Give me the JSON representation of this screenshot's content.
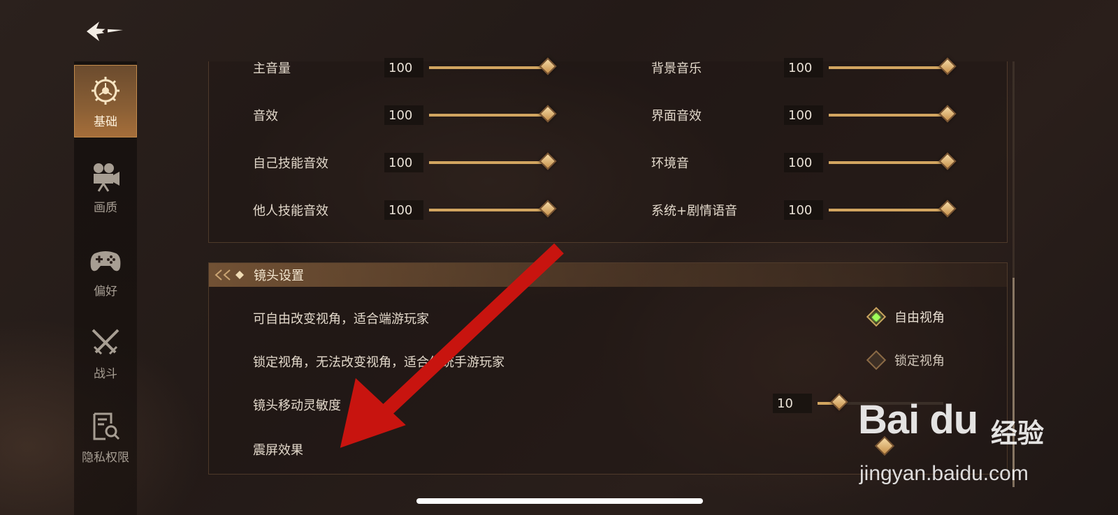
{
  "sidebar": {
    "back_icon": "back-arrow-icon",
    "items": [
      {
        "label": "基础",
        "icon": "gear-icon",
        "active": true
      },
      {
        "label": "画质",
        "icon": "camera-icon",
        "active": false
      },
      {
        "label": "偏好",
        "icon": "gamepad-icon",
        "active": false
      },
      {
        "label": "战斗",
        "icon": "crossed-swords-icon",
        "active": false
      },
      {
        "label": "隐私权限",
        "icon": "privacy-search-icon",
        "active": false
      }
    ]
  },
  "sound": {
    "rows": [
      {
        "label": "主音量",
        "value": "100"
      },
      {
        "label": "背景音乐",
        "value": "100"
      },
      {
        "label": "音效",
        "value": "100"
      },
      {
        "label": "界面音效",
        "value": "100"
      },
      {
        "label": "自己技能音效",
        "value": "100"
      },
      {
        "label": "环境音",
        "value": "100"
      },
      {
        "label": "他人技能音效",
        "value": "100"
      },
      {
        "label": "系统+剧情语音",
        "value": "100"
      }
    ]
  },
  "camera": {
    "title": "镜头设置",
    "free_desc": "可自由改变视角，适合端游玩家",
    "free_option": "自由视角",
    "lock_desc": "锁定视角，无法改变视角，适合传统手游玩家",
    "lock_option": "锁定视角",
    "sensitivity_label": "镜头移动灵敏度",
    "sensitivity_value": "10",
    "sensitivity_fraction": 0.17,
    "shake_label": "震屏效果"
  },
  "watermark": {
    "logo": "Bai du",
    "cn": "经验",
    "url": "jingyan.baidu.com"
  },
  "colors": {
    "accent": "#d2a560",
    "active_tab": "#8a5f35",
    "selected_radio": "#9eff5a",
    "arrow": "#c8140f"
  }
}
